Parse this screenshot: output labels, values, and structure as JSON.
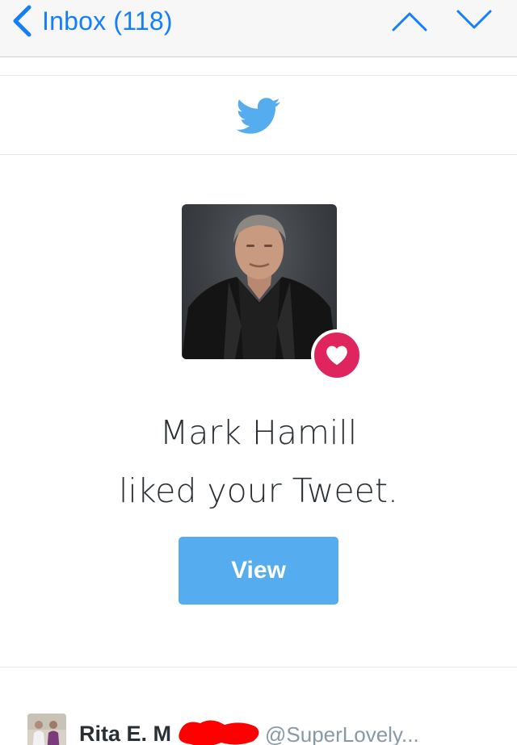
{
  "navbar": {
    "back_label": "Inbox (118)",
    "accent_color": "#157efb",
    "icons": [
      "chevron-left-icon",
      "chevron-up-icon",
      "chevron-down-icon"
    ]
  },
  "email": {
    "logo": "twitter-bird-icon",
    "brand_color": "#55acee",
    "like_color": "#e0245e",
    "liker_name": "Mark Hamill",
    "action_text": "liked your Tweet.",
    "view_button": "View"
  },
  "tweet_preview": {
    "author_name": "Rita E. M",
    "author_handle": "@SuperLovely..."
  }
}
